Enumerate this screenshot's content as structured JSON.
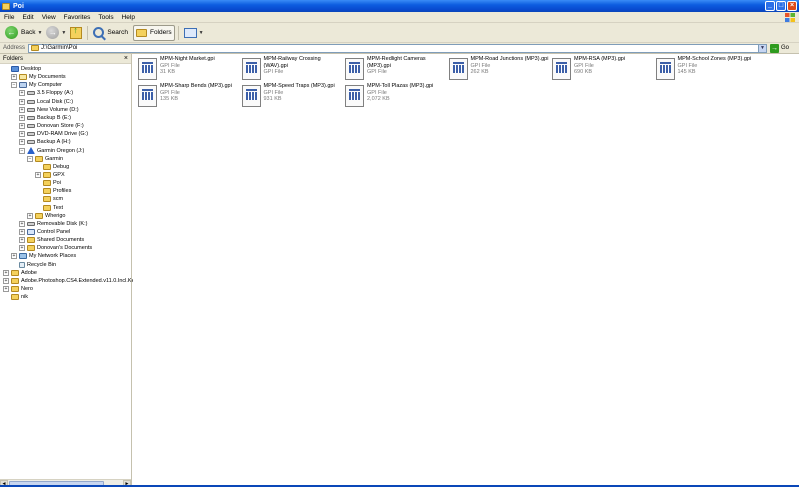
{
  "window": {
    "title": "Poi"
  },
  "menu": [
    "File",
    "Edit",
    "View",
    "Favorites",
    "Tools",
    "Help"
  ],
  "toolbar": {
    "back": "Back",
    "search": "Search",
    "folders": "Folders"
  },
  "address": {
    "label": "Address",
    "value": "J:\\Garmin\\Poi",
    "go": "Go"
  },
  "folders_pane": {
    "title": "Folders",
    "nodes": [
      {
        "label": "Desktop",
        "icon": "desktop-icon",
        "exp": ""
      },
      {
        "label": "My Documents",
        "icon": "documents-icon",
        "exp": "+"
      },
      {
        "label": "My Computer",
        "icon": "computer-icon",
        "exp": "−"
      },
      {
        "label": "3.5 Floppy (A:)",
        "icon": "floppy-icon",
        "exp": "+"
      },
      {
        "label": "Local Disk (C:)",
        "icon": "drive-icon",
        "exp": "+"
      },
      {
        "label": "New Volume (D:)",
        "icon": "drive-icon",
        "exp": "+"
      },
      {
        "label": "Backup B (E:)",
        "icon": "drive-icon",
        "exp": "+"
      },
      {
        "label": "Donovan Store (F:)",
        "icon": "drive-icon",
        "exp": "+"
      },
      {
        "label": "DVD-RAM Drive (G:)",
        "icon": "dvd-icon",
        "exp": "+"
      },
      {
        "label": "Backup A (H:)",
        "icon": "drive-icon",
        "exp": "+"
      },
      {
        "label": "Garmin Oregon (J:)",
        "icon": "garmin-icon",
        "exp": "−"
      },
      {
        "label": "Garmin",
        "icon": "folder-icon",
        "exp": "−"
      },
      {
        "label": "Debug",
        "icon": "folder-icon",
        "exp": ""
      },
      {
        "label": "GPX",
        "icon": "folder-icon",
        "exp": "+"
      },
      {
        "label": "Poi",
        "icon": "folder-icon",
        "exp": ""
      },
      {
        "label": "Profiles",
        "icon": "folder-icon",
        "exp": ""
      },
      {
        "label": "scm",
        "icon": "folder-icon",
        "exp": ""
      },
      {
        "label": "Text",
        "icon": "folder-icon",
        "exp": ""
      },
      {
        "label": "Wherigo",
        "icon": "folder-icon",
        "exp": "+"
      },
      {
        "label": "Removable Disk (K:)",
        "icon": "drive-icon",
        "exp": "+"
      },
      {
        "label": "Control Panel",
        "icon": "control-panel-icon",
        "exp": "+"
      },
      {
        "label": "Shared Documents",
        "icon": "folder-icon",
        "exp": "+"
      },
      {
        "label": "Donovan's Documents",
        "icon": "folder-icon",
        "exp": "+"
      },
      {
        "label": "My Network Places",
        "icon": "network-icon",
        "exp": "+"
      },
      {
        "label": "Recycle Bin",
        "icon": "recycle-bin-icon",
        "exp": ""
      },
      {
        "label": "Adobe",
        "icon": "folder-icon",
        "exp": "+"
      },
      {
        "label": "Adobe.Photoshop.CS4.Extended.v11.0.Incl.Keymaker",
        "icon": "folder-icon",
        "exp": "+"
      },
      {
        "label": "Nero",
        "icon": "folder-icon",
        "exp": "+"
      },
      {
        "label": "nik",
        "icon": "folder-icon",
        "exp": ""
      }
    ]
  },
  "files": [
    {
      "name": "MPM-Night Market.gpi",
      "type": "GPI File",
      "size": "31 KB"
    },
    {
      "name": "MPM-Railway Crossing (WAV).gpi",
      "type": "GPI File",
      "size": ""
    },
    {
      "name": "MPM-Redlight Cameras (MP3).gpi",
      "type": "GPI File",
      "size": ""
    },
    {
      "name": "MPM-Road Junctions (MP3).gpi",
      "type": "GPI File",
      "size": "262 KB"
    },
    {
      "name": "MPM-RSA (MP3).gpi",
      "type": "GPI File",
      "size": "690 KB"
    },
    {
      "name": "MPM-School Zones (MP3).gpi",
      "type": "GPI File",
      "size": "145 KB"
    },
    {
      "name": "MPM-Sharp Bends (MP3).gpi",
      "type": "GPI File",
      "size": "135 KB"
    },
    {
      "name": "MPM-Speed Traps (MP3).gpi",
      "type": "GPI File",
      "size": "931 KB"
    },
    {
      "name": "MPM-Toll Plazas (MP3).gpi",
      "type": "GPI File",
      "size": "2,072 KB"
    }
  ]
}
